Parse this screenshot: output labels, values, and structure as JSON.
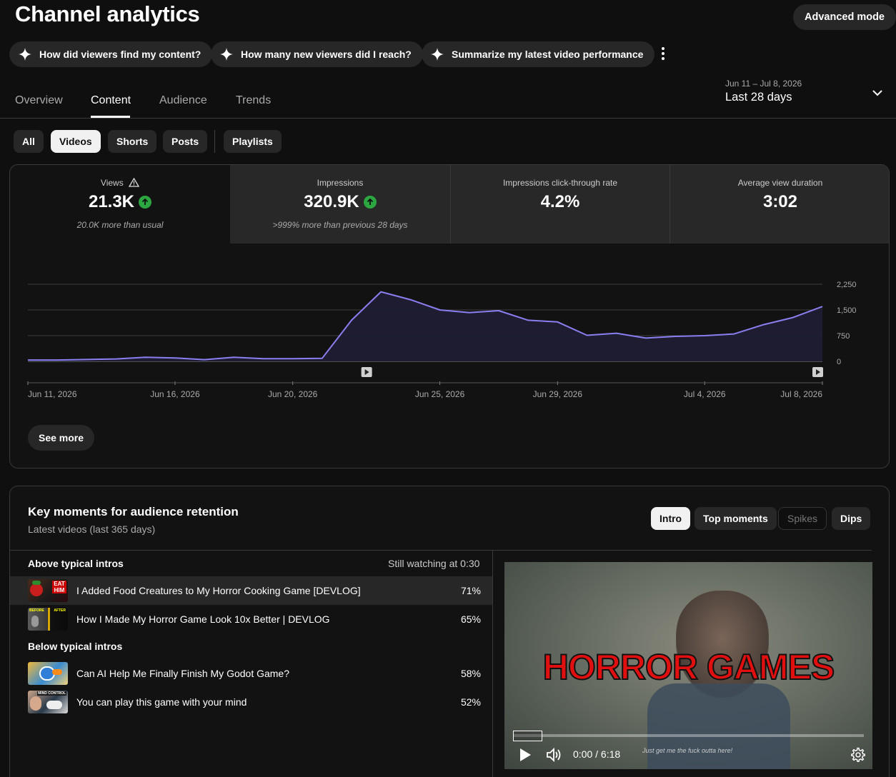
{
  "header": {
    "title": "Channel analytics",
    "advanced_mode": "Advanced mode"
  },
  "questions": [
    "How did viewers find my content?",
    "How many new viewers did I reach?",
    "Summarize my latest video performance"
  ],
  "tabs": [
    "Overview",
    "Content",
    "Audience",
    "Trends"
  ],
  "active_tab": "Content",
  "date_range": {
    "dates": "Jun 11 – Jul 8, 2026",
    "label": "Last 28 days"
  },
  "filters": [
    "All",
    "Videos",
    "Shorts",
    "Posts",
    "Playlists"
  ],
  "selected_filter": "Videos",
  "metrics": [
    {
      "label": "Views",
      "value": "21.3K",
      "sub": "20.0K more than usual",
      "warning": true,
      "trend": "up",
      "selected": true
    },
    {
      "label": "Impressions",
      "value": "320.9K",
      "sub": ">999% more than previous 28 days",
      "trend": "up",
      "selected": false
    },
    {
      "label": "Impressions click-through rate",
      "value": "4.2%",
      "sub": "",
      "selected": false
    },
    {
      "label": "Average view duration",
      "value": "3:02",
      "sub": "",
      "selected": false
    }
  ],
  "chart_data": {
    "type": "area",
    "x": [
      "Jun 11, 2026",
      "Jun 12, 2026",
      "Jun 13, 2026",
      "Jun 14, 2026",
      "Jun 15, 2026",
      "Jun 16, 2026",
      "Jun 17, 2026",
      "Jun 18, 2026",
      "Jun 19, 2026",
      "Jun 20, 2026",
      "Jun 21, 2026",
      "Jun 22, 2026",
      "Jun 23, 2026",
      "Jun 24, 2026",
      "Jun 25, 2026",
      "Jun 26, 2026",
      "Jun 27, 2026",
      "Jun 28, 2026",
      "Jun 29, 2026",
      "Jun 30, 2026",
      "Jul 1, 2026",
      "Jul 2, 2026",
      "Jul 3, 2026",
      "Jul 4, 2026",
      "Jul 5, 2026",
      "Jul 6, 2026",
      "Jul 7, 2026",
      "Jul 8, 2026"
    ],
    "series": [
      {
        "values": [
          40,
          40,
          55,
          70,
          120,
          100,
          50,
          120,
          80,
          80,
          90,
          1200,
          2030,
          1800,
          1500,
          1420,
          1480,
          1200,
          1150,
          760,
          820,
          680,
          730,
          750,
          800,
          1070,
          1280,
          1600
        ]
      }
    ],
    "x_tick_labels": [
      "Jun 11, 2026",
      "Jun 16, 2026",
      "Jun 20, 2026",
      "Jun 25, 2026",
      "Jun 29, 2026",
      "Jul 4, 2026",
      "Jul 8, 2026"
    ],
    "y_ticks": [
      "2,250",
      "1,500",
      "750",
      "0"
    ],
    "ylim": [
      0,
      2250
    ],
    "grid": true,
    "color": "#8a7ff0"
  },
  "see_more": "See more",
  "key_moments": {
    "title": "Key moments for audience retention",
    "subtitle": "Latest videos (last 365 days)",
    "segments": [
      "Intro",
      "Top moments",
      "Spikes",
      "Dips"
    ],
    "selected_segment": "Intro",
    "still_watching": "Still watching at 0:30",
    "above_label": "Above typical intros",
    "below_label": "Below typical intros",
    "above": [
      {
        "title": "I Added Food Creatures to My Horror Cooking Game [DEVLOG]",
        "pct": "71%"
      },
      {
        "title": "How I Made My Horror Game Look 10x Better | DEVLOG",
        "pct": "65%"
      }
    ],
    "below": [
      {
        "title": "Can AI Help Me Finally Finish My Godot Game?",
        "pct": "58%"
      },
      {
        "title": "You can play this game with your mind",
        "pct": "52%"
      }
    ],
    "thumb_text": {
      "t1": "EAT HIM",
      "t2a": "BEFORE",
      "t2b": "AFTER",
      "t4": "MIND CONTROL"
    }
  },
  "player": {
    "overlay": "HORROR GAMES",
    "time": "0:00 / 6:18",
    "caption": "Just get me the fuck outta here!"
  },
  "colors": {
    "accent_up": "#2ba640",
    "chart_line": "#8a7ff0",
    "bg": "#0f0f0f",
    "chip": "#272727"
  }
}
